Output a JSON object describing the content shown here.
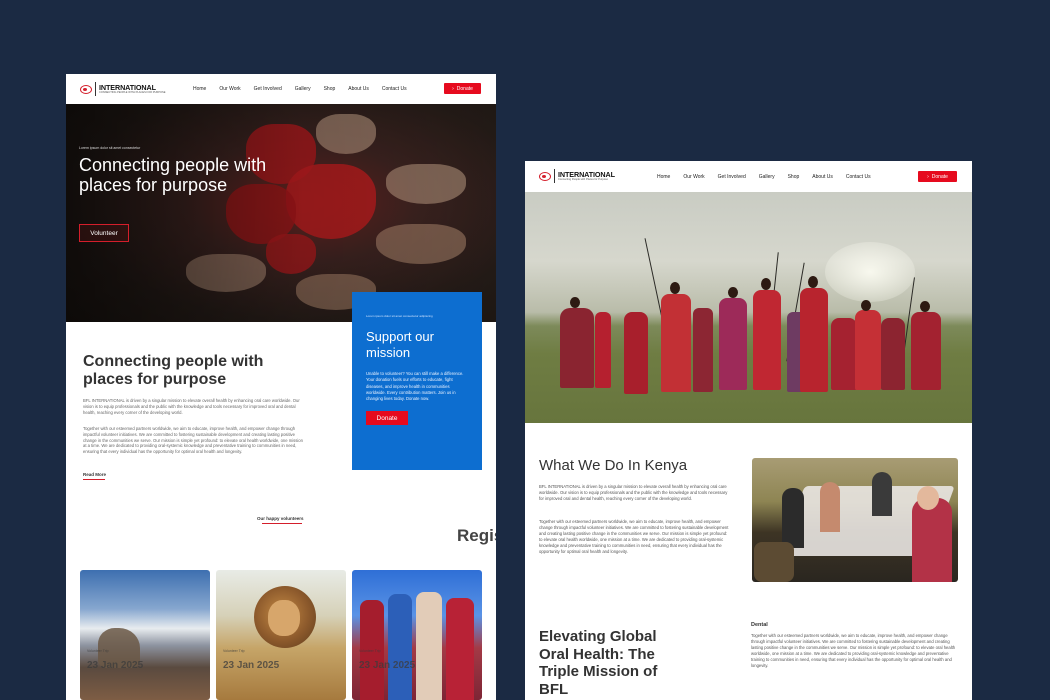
{
  "brand": {
    "name": "INTERNATIONAL",
    "tagline_left": "CONNECTING PEOPLE WITH PLACES FOR PURPOSE",
    "tagline_right": "Connecting People with Places for Purpose"
  },
  "nav": {
    "items": [
      "Home",
      "Our Work",
      "Get Involved",
      "Gallery",
      "Shop",
      "About Us",
      "Contact Us"
    ],
    "donate_label": "Donate",
    "donate_arrow": "›"
  },
  "left_page": {
    "hero": {
      "eyebrow": "Lorem ipsum dolor sit amet consectetur",
      "title": "Connecting people with places for purpose",
      "volunteer_label": "Volunteer"
    },
    "support": {
      "eyebrow": "Lorem ipsum dolor sit amet consectetur adipiscing",
      "title": "Support our mission",
      "text": "Unable to volunteer? You can still make a difference. Your donation fuels our efforts to educate, fight diseases, and improve health in communities worldwide. Every contribution matters. Join us in changing lives today. Donate now.",
      "donate_label": "Donate"
    },
    "section": {
      "title": "Connecting people with places for purpose",
      "para1": "BFL INTERNATIONAL is driven by a singular mission to elevate overall health by enhancing oral care worldwide. Our vision is to equip professionals and the public with the knowledge and tools necessary for improved oral and dental health, reaching every corner of the developing world.",
      "para2": "Together with our esteemed partners worldwide, we aim to educate, improve health, and empower change through impactful volunteer initiatives. We are committed to fostering sustainable development and creating lasting positive change in the communities we serve. Our mission is simple yet profound: to elevate oral health worldwide, one mission at a time. We are dedicated to providing oral-systemic knowledge and preventative training to communities in need, ensuring that every individual has the opportunity for optimal oral health and longevity.",
      "read_more": "Read More"
    },
    "volunteers_label": "Our happy volunteers",
    "register_label": "Regis",
    "cards": [
      {
        "small": "Volunteer Trip",
        "date": "23 Jan 2025"
      },
      {
        "small": "Volunteer Trip",
        "date": "23 Jan 2025"
      },
      {
        "small": "Volunteer Trip",
        "date": "23 Jan 2025"
      }
    ]
  },
  "right_page": {
    "kenya": {
      "title": "What We Do In Kenya",
      "para1": "BFL INTERNATIONAL is driven by a singular mission to elevate overall health by enhancing oral care worldwide. Our vision is to equip professionals and the public with the knowledge and tools necessary for improved oral and dental health, reaching every corner of the developing world.",
      "para2": "Together with our esteemed partners worldwide, we aim to educate, improve health, and empower change through impactful volunteer initiatives. We are committed to fostering sustainable development and creating lasting positive change in the communities we serve. Our mission is simple yet profound: to elevate oral health worldwide, one mission at a time. We are dedicated to providing oral-systemic knowledge and preventative training to communities in need, ensuring that every individual has the opportunity for optimal oral health and longevity."
    },
    "elevating": {
      "title": "Elevating Global Oral Health: The Triple Mission of BFL",
      "dental_label": "Dental",
      "dental_text": "Together with our esteemed partners worldwide, we aim to educate, improve health, and empower change through impactful volunteer initiatives. We are committed to fostering sustainable development and creating lasting positive change in the communities we serve. Our mission is simple yet profound: to elevate oral health worldwide, one mission at a time. We are dedicated to providing oral-systemic knowledge and preventative training to communities in need, ensuring that every individual has the opportunity for optimal oral health and longevity."
    }
  },
  "colors": {
    "background": "#1b2a43",
    "accent_red": "#e60a1e",
    "support_blue": "#0d6ed0"
  },
  "icons": [
    "logo-mark-icon",
    "arrow-right-icon"
  ]
}
